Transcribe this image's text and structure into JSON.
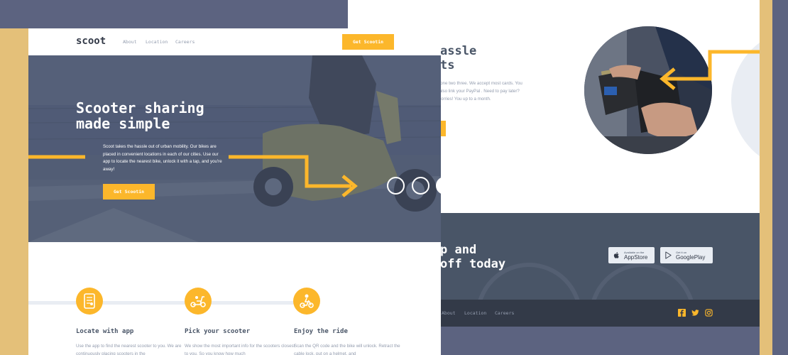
{
  "front": {
    "nav": {
      "logo": "scoot",
      "links": [
        "About",
        "Location",
        "Careers"
      ],
      "cta": "Get Scootin"
    },
    "hero": {
      "title_line1": "Scooter sharing",
      "title_line2": "made simple",
      "paragraph": "Scoot takes the hassle out of urban mobility. Our bikes are placed in convenient locations in each of our cities. Use our app to locate the nearest bike, unlock it with a tap, and you're away!",
      "cta": "Get Scootin"
    },
    "features": [
      {
        "title": "Locate with app",
        "icon": "phone-map-icon",
        "text": "Use the app to find the nearest scooter to you. We are continuously placing scooters in the"
      },
      {
        "title": "Pick your scooter",
        "icon": "scooter-icon",
        "text": "We show the most important info for the scooters closest to you. So you know how much"
      },
      {
        "title": "Enjoy the ride",
        "icon": "rider-icon",
        "text": "Scan the QR code and the bike will unlock. Retract the cable lock, put on a helmet, and"
      }
    ]
  },
  "back": {
    "section": {
      "title_line1": "assle",
      "title_line2": "ts",
      "paragraph": "y as one two three. We accept most cards. You can also link your PayPal . Need to pay later? No worries! You up to a month."
    },
    "app_band": {
      "title_line1": "p and",
      "title_line2": "off today",
      "appstore_small": "Available on the",
      "appstore_big": "AppStore",
      "google_small": "Get it on",
      "google_big": "GooglePlay"
    },
    "footer": {
      "links": [
        "About",
        "Location",
        "Careers"
      ],
      "social": [
        "facebook-icon",
        "twitter-icon",
        "instagram-icon"
      ]
    }
  },
  "colors": {
    "accent": "#fcb72b",
    "dark_navy": "#333a48",
    "slate": "#495567",
    "background": "#5c6380",
    "frame": "#e4c079"
  }
}
